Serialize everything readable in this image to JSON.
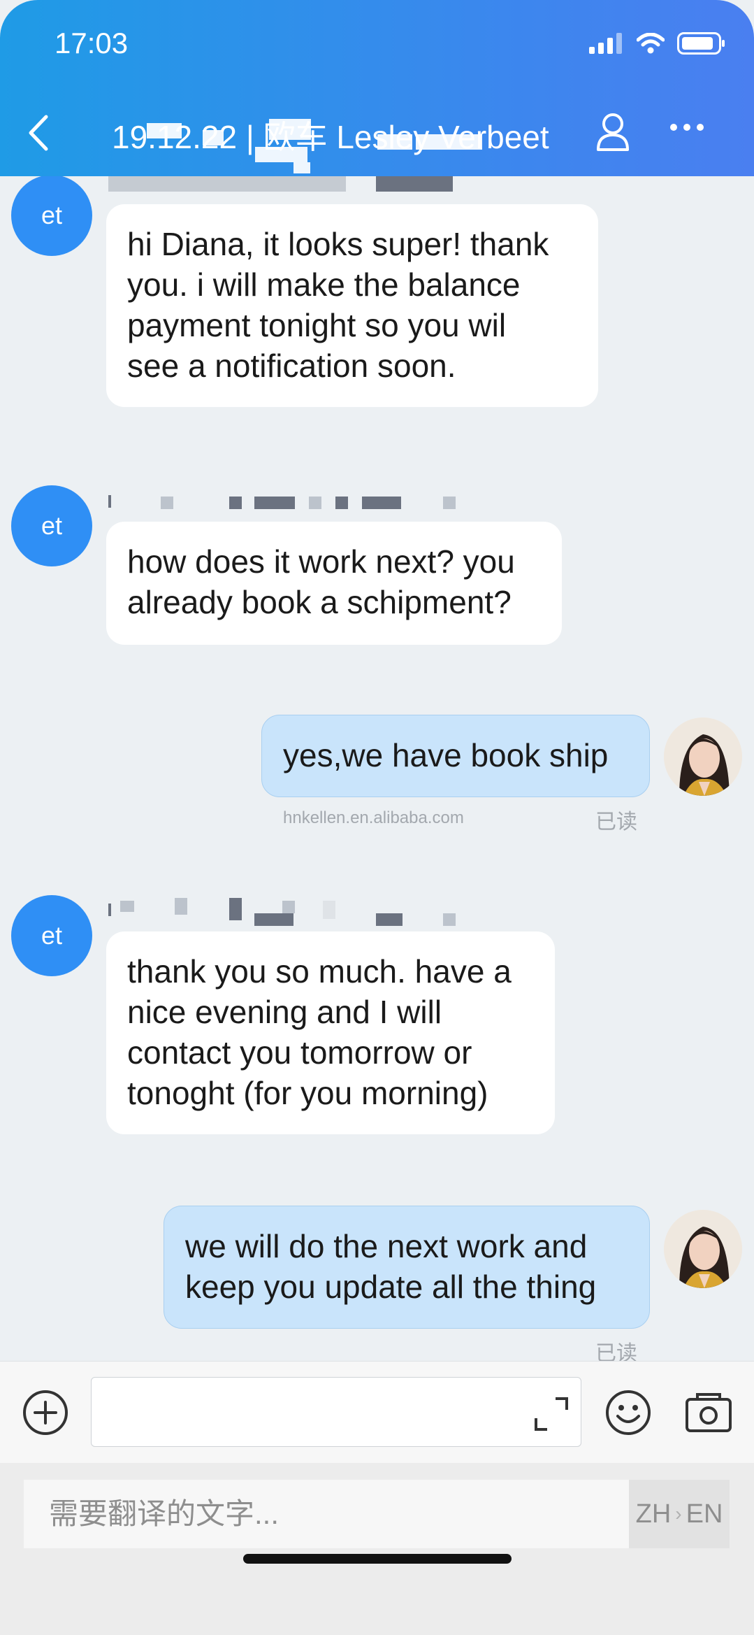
{
  "status": {
    "time": "17:03"
  },
  "header": {
    "title": "19.12.22 | 欧车 Lesley Verbeet"
  },
  "messages": [
    {
      "sender": "et",
      "text_lines": [
        "hi Diana, it looks super! thank",
        "you. i will make the balance",
        "payment tonight so you wil",
        "see a notification soon."
      ]
    },
    {
      "sender": "et",
      "text_lines": [
        "how does it work next? you",
        "already book a schipment?"
      ]
    },
    {
      "sender": "me",
      "text_lines": [
        "yes,we have book ship"
      ],
      "email": "hnkellen.en.alibaba.com",
      "read": "已读"
    },
    {
      "sender": "et",
      "text_lines": [
        "thank you so much. have a",
        "nice evening and I will",
        "contact you tomorrow or",
        "tonoght (for you morning)"
      ]
    },
    {
      "sender": "me",
      "text_lines": [
        "we will do the next work and",
        "keep you update all the thing"
      ],
      "read": "已读"
    }
  ],
  "avatar": {
    "label": "et"
  },
  "translate": {
    "placeholder": "需要翻译的文字...",
    "from": "ZH",
    "to": "EN"
  },
  "colors": {
    "header_start": "#1f9be6",
    "header_end": "#4a7ff0",
    "avatar_blue": "#2f8ff5",
    "outgoing_bubble": "#c9e4fb"
  }
}
